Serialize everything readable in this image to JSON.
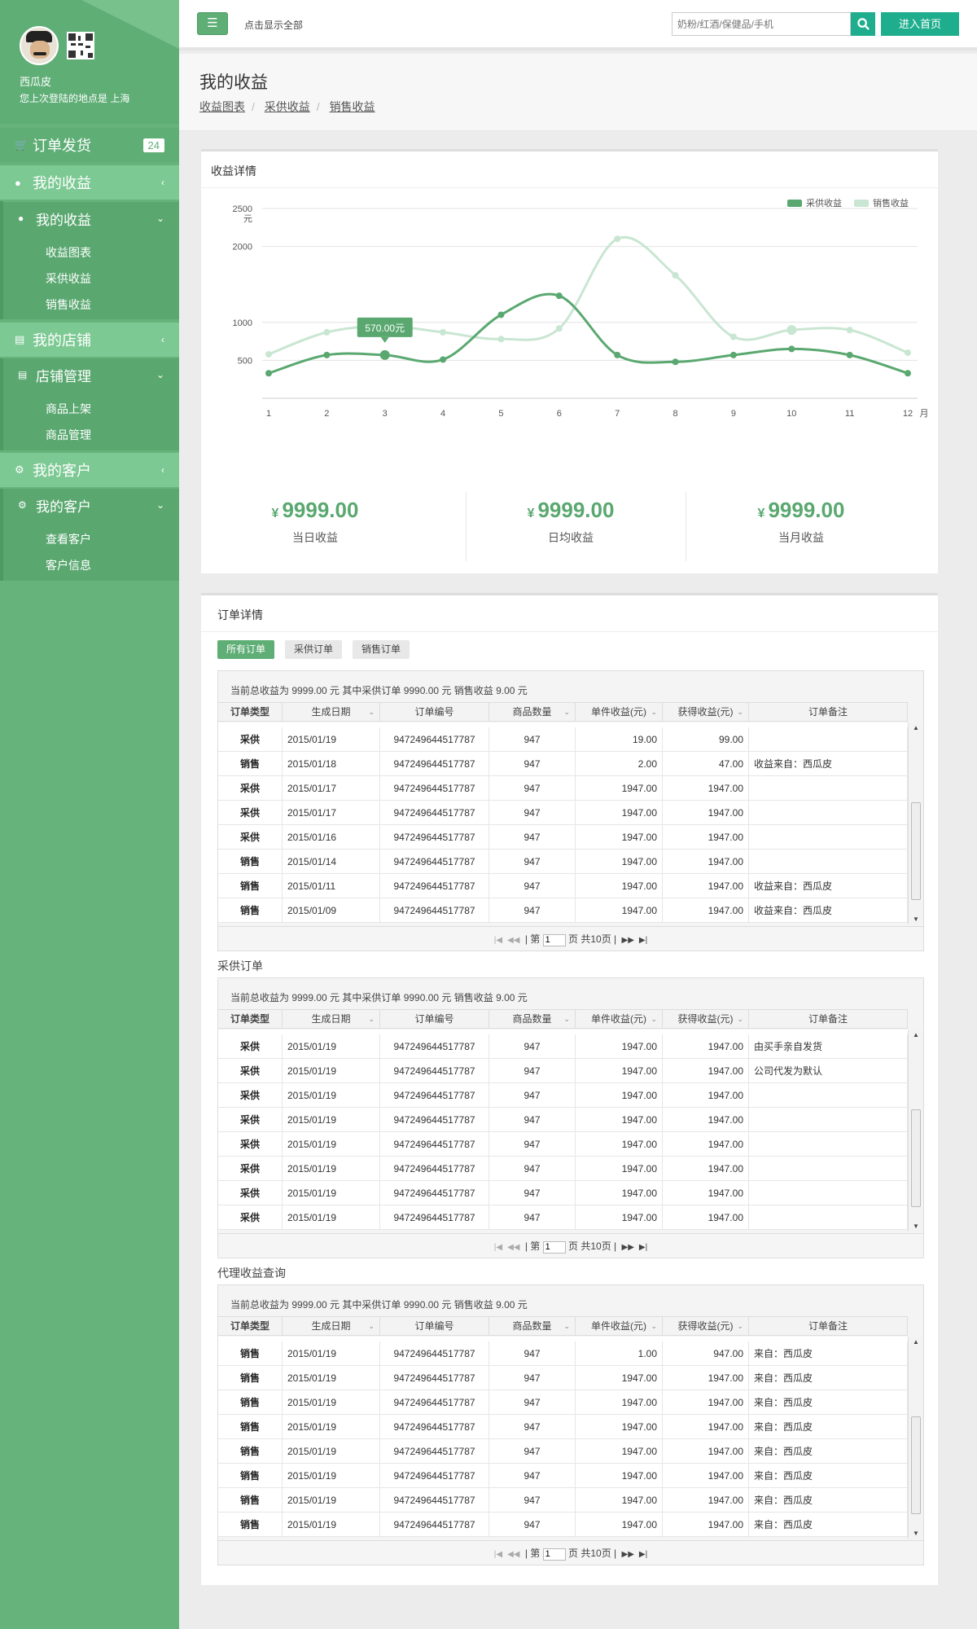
{
  "sidebar": {
    "username": "西瓜皮",
    "last_login": "您上次登陆的地点是 上海",
    "menu": {
      "orders": {
        "label": "订单发货",
        "badge": "24",
        "icon": "cart-icon"
      },
      "earnings": {
        "label": "我的收益",
        "icon": "user-icon"
      },
      "earnings_sub": {
        "label": "我的收益",
        "items": [
          "收益图表",
          "采供收益",
          "销售收益"
        ]
      },
      "shop": {
        "label": "我的店铺",
        "icon": "id-card-icon"
      },
      "shop_sub": {
        "label": "店铺管理",
        "items": [
          "商品上架",
          "商品管理"
        ]
      },
      "customers": {
        "label": "我的客户",
        "icon": "gear-icon"
      },
      "customers_sub": {
        "label": "我的客户",
        "items": [
          "查看客户",
          "客户信息"
        ]
      }
    }
  },
  "topbar": {
    "show_all": "点击显示全部",
    "search_placeholder": "奶粉/红酒/保健品/手机",
    "home_button": "进入首页"
  },
  "page": {
    "title": "我的收益",
    "breadcrumbs": [
      "收益图表",
      "采供收益",
      "销售收益"
    ]
  },
  "earnings_panel": {
    "title": "收益详情",
    "stats": [
      {
        "currency": "¥",
        "amount": "9999.00",
        "label": "当日收益"
      },
      {
        "currency": "¥",
        "amount": "9999.00",
        "label": "日均收益"
      },
      {
        "currency": "¥",
        "amount": "9999.00",
        "label": "当月收益"
      }
    ],
    "tooltip": "570.00元"
  },
  "chart_data": {
    "type": "line",
    "categories": [
      "1",
      "2",
      "3",
      "4",
      "5",
      "6",
      "7",
      "8",
      "9",
      "10",
      "11",
      "12"
    ],
    "xlabel": "月",
    "ylabel": "元",
    "ylim": [
      0,
      2500
    ],
    "yticks": [
      "500",
      "1000",
      "2000",
      "2500"
    ],
    "legend": "top-right",
    "grid": true,
    "series": [
      {
        "name": "采供收益",
        "color": "#5aa870",
        "values": [
          330,
          570,
          570,
          510,
          1100,
          1350,
          570,
          480,
          570,
          650,
          570,
          330
        ]
      },
      {
        "name": "销售收益",
        "color": "#c9e6d2",
        "values": [
          580,
          870,
          950,
          870,
          780,
          920,
          2100,
          1620,
          810,
          900,
          900,
          600
        ]
      }
    ]
  },
  "orders_panel": {
    "title": "订单详情",
    "tabs": [
      "所有订单",
      "采供订单",
      "销售订单"
    ],
    "columns": [
      "订单类型",
      "生成日期",
      "订单编号",
      "商品数量",
      "单件收益(元)",
      "获得收益(元)",
      "订单备注"
    ],
    "summary": "当前总收益为 9999.00 元 其中采供订单 9990.00 元   销售收益 9.00 元",
    "pager": {
      "prefix": "第",
      "page": "1",
      "suffix": "页",
      "total": "共10页"
    },
    "grids": [
      {
        "title": "",
        "rows": [
          [
            "采供",
            "2015/01/19",
            "947249644517787",
            "947",
            "19.00",
            "99.00",
            ""
          ],
          [
            "销售",
            "2015/01/18",
            "947249644517787",
            "947",
            "2.00",
            "47.00",
            "收益来自：西瓜皮"
          ],
          [
            "采供",
            "2015/01/17",
            "947249644517787",
            "947",
            "1947.00",
            "1947.00",
            ""
          ],
          [
            "采供",
            "2015/01/17",
            "947249644517787",
            "947",
            "1947.00",
            "1947.00",
            ""
          ],
          [
            "采供",
            "2015/01/16",
            "947249644517787",
            "947",
            "1947.00",
            "1947.00",
            ""
          ],
          [
            "销售",
            "2015/01/14",
            "947249644517787",
            "947",
            "1947.00",
            "1947.00",
            ""
          ],
          [
            "销售",
            "2015/01/11",
            "947249644517787",
            "947",
            "1947.00",
            "1947.00",
            "收益来自：西瓜皮"
          ],
          [
            "销售",
            "2015/01/09",
            "947249644517787",
            "947",
            "1947.00",
            "1947.00",
            "收益来自：西瓜皮"
          ]
        ]
      },
      {
        "title": "采供订单",
        "rows": [
          [
            "采供",
            "2015/01/19",
            "947249644517787",
            "947",
            "1947.00",
            "1947.00",
            "由买手亲自发货"
          ],
          [
            "采供",
            "2015/01/19",
            "947249644517787",
            "947",
            "1947.00",
            "1947.00",
            "公司代发为默认"
          ],
          [
            "采供",
            "2015/01/19",
            "947249644517787",
            "947",
            "1947.00",
            "1947.00",
            ""
          ],
          [
            "采供",
            "2015/01/19",
            "947249644517787",
            "947",
            "1947.00",
            "1947.00",
            ""
          ],
          [
            "采供",
            "2015/01/19",
            "947249644517787",
            "947",
            "1947.00",
            "1947.00",
            ""
          ],
          [
            "采供",
            "2015/01/19",
            "947249644517787",
            "947",
            "1947.00",
            "1947.00",
            ""
          ],
          [
            "采供",
            "2015/01/19",
            "947249644517787",
            "947",
            "1947.00",
            "1947.00",
            ""
          ],
          [
            "采供",
            "2015/01/19",
            "947249644517787",
            "947",
            "1947.00",
            "1947.00",
            ""
          ]
        ]
      },
      {
        "title": "代理收益查询",
        "rows": [
          [
            "销售",
            "2015/01/19",
            "947249644517787",
            "947",
            "1.00",
            "947.00",
            "来自：西瓜皮"
          ],
          [
            "销售",
            "2015/01/19",
            "947249644517787",
            "947",
            "1947.00",
            "1947.00",
            "来自：西瓜皮"
          ],
          [
            "销售",
            "2015/01/19",
            "947249644517787",
            "947",
            "1947.00",
            "1947.00",
            "来自：西瓜皮"
          ],
          [
            "销售",
            "2015/01/19",
            "947249644517787",
            "947",
            "1947.00",
            "1947.00",
            "来自：西瓜皮"
          ],
          [
            "销售",
            "2015/01/19",
            "947249644517787",
            "947",
            "1947.00",
            "1947.00",
            "来自：西瓜皮"
          ],
          [
            "销售",
            "2015/01/19",
            "947249644517787",
            "947",
            "1947.00",
            "1947.00",
            "来自：西瓜皮"
          ],
          [
            "销售",
            "2015/01/19",
            "947249644517787",
            "947",
            "1947.00",
            "1947.00",
            "来自：西瓜皮"
          ],
          [
            "销售",
            "2015/01/19",
            "947249644517787",
            "947",
            "1947.00",
            "1947.00",
            "来自：西瓜皮"
          ]
        ]
      }
    ]
  }
}
